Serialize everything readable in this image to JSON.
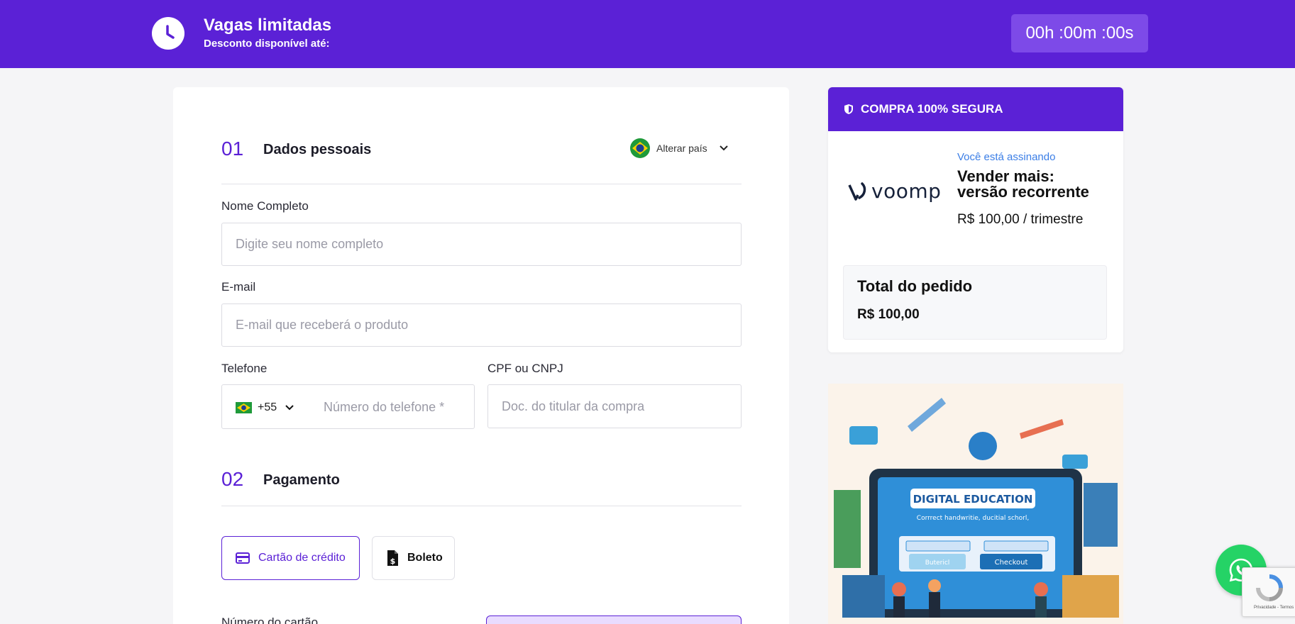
{
  "header": {
    "title": "Vagas limitadas",
    "subtitle": "Desconto disponível até:",
    "timer": "00h :00m :00s",
    "accent": "#5b21d6"
  },
  "form": {
    "section1": {
      "number": "01",
      "title": "Dados pessoais",
      "country_label": "Alterar país"
    },
    "name": {
      "label": "Nome Completo",
      "placeholder": "Digite seu nome completo"
    },
    "email": {
      "label": "E-mail",
      "placeholder": "E-mail que receberá o produto"
    },
    "phone": {
      "label": "Telefone",
      "ddi": "+55",
      "placeholder": "Número do telefone *"
    },
    "doc": {
      "label": "CPF ou CNPJ",
      "placeholder": "Doc. do titular da compra"
    },
    "section2": {
      "number": "02",
      "title": "Pagamento"
    },
    "payment_methods": [
      {
        "label": "Cartão de crédito",
        "icon": "credit-card-icon",
        "selected": true
      },
      {
        "label": "Boleto",
        "icon": "boleto-icon",
        "selected": false
      }
    ],
    "card_number_label": "Número do cartão"
  },
  "summary": {
    "header": "COMPRA 100% SEGURA",
    "logo_text": "voomp",
    "subscribing_label": "Você está assinando",
    "product_name": "Vender mais: versão recorrente",
    "price": "R$ 100,00 / trimestre",
    "total_label": "Total do pedido",
    "total_value": "R$ 100,00"
  },
  "banner": {
    "heading": "DIGITAL EDUCATION",
    "caption": "Corrrect handwritie, ducitial schorl,",
    "button_left": "Butericl",
    "button_right": "Checkout"
  },
  "recaptcha": {
    "text": "Privacidade - Termos"
  }
}
